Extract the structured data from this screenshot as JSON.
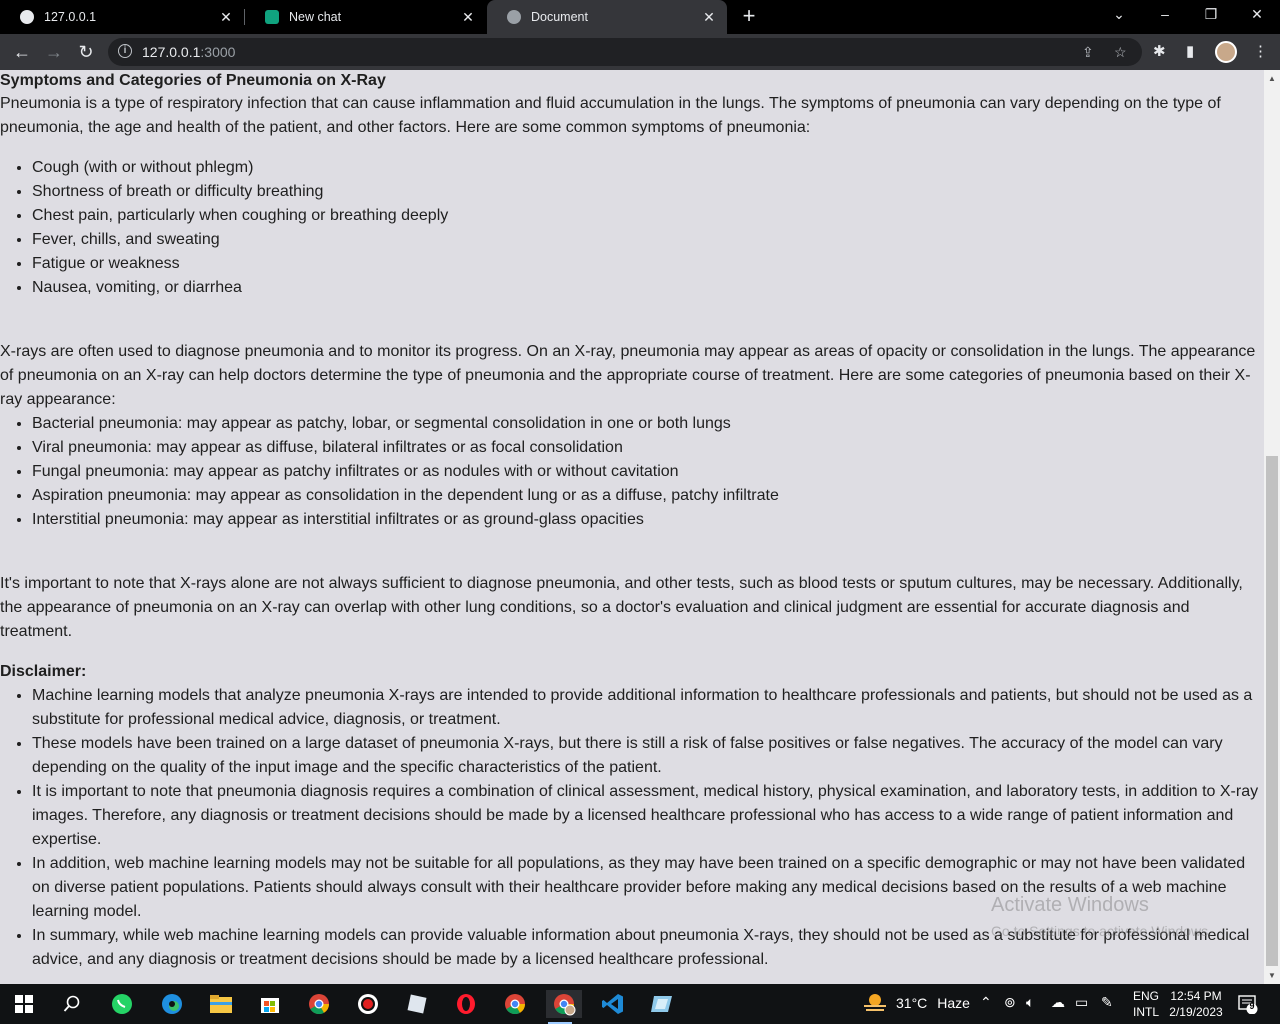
{
  "browser": {
    "tabs": [
      {
        "title": "127.0.0.1",
        "icon": "globe-icon"
      },
      {
        "title": "New chat",
        "icon": "chatgpt-icon"
      },
      {
        "title": "Document",
        "icon": "globe-icon",
        "active": true
      }
    ],
    "url_host": "127.0.0.1",
    "url_port": ":3000"
  },
  "page": {
    "heading": "Symptoms and Categories of Pneumonia on X-Ray",
    "intro": "Pneumonia is a type of respiratory infection that can cause inflammation and fluid accumulation in the lungs. The symptoms of pneumonia can vary depending on the type of pneumonia, the age and health of the patient, and other factors. Here are some common symptoms of pneumonia:",
    "symptoms": [
      "Cough (with or without phlegm)",
      "Shortness of breath or difficulty breathing",
      "Chest pain, particularly when coughing or breathing deeply",
      "Fever, chills, and sweating",
      "Fatigue or weakness",
      "Nausea, vomiting, or diarrhea"
    ],
    "xray_intro": "X-rays are often used to diagnose pneumonia and to monitor its progress. On an X-ray, pneumonia may appear as areas of opacity or consolidation in the lungs. The appearance of pneumonia on an X-ray can help doctors determine the type of pneumonia and the appropriate course of treatment. Here are some categories of pneumonia based on their X-ray appearance:",
    "categories": [
      "Bacterial pneumonia: may appear as patchy, lobar, or segmental consolidation in one or both lungs",
      "Viral pneumonia: may appear as diffuse, bilateral infiltrates or as focal consolidation",
      "Fungal pneumonia: may appear as patchy infiltrates or as nodules with or without cavitation",
      "Aspiration pneumonia: may appear as consolidation in the dependent lung or as a diffuse, patchy infiltrate",
      "Interstitial pneumonia: may appear as interstitial infiltrates or as ground-glass opacities"
    ],
    "note": "It's important to note that X-rays alone are not always sufficient to diagnose pneumonia, and other tests, such as blood tests or sputum cultures, may be necessary. Additionally, the appearance of pneumonia on an X-ray can overlap with other lung conditions, so a doctor's evaluation and clinical judgment are essential for accurate diagnosis and treatment.",
    "disclaimer_title": "Disclaimer:",
    "disclaimers": [
      "Machine learning models that analyze pneumonia X-rays are intended to provide additional information to healthcare professionals and patients, but should not be used as a substitute for professional medical advice, diagnosis, or treatment.",
      "These models have been trained on a large dataset of pneumonia X-rays, but there is still a risk of false positives or false negatives. The accuracy of the model can vary depending on the quality of the input image and the specific characteristics of the patient.",
      "It is important to note that pneumonia diagnosis requires a combination of clinical assessment, medical history, physical examination, and laboratory tests, in addition to X-ray images. Therefore, any diagnosis or treatment decisions should be made by a licensed healthcare professional who has access to a wide range of patient information and expertise.",
      "In addition, web machine learning models may not be suitable for all populations, as they may have been trained on a specific demographic or may not have been validated on diverse patient populations. Patients should always consult with their healthcare provider before making any medical decisions based on the results of a web machine learning model.",
      "In summary, while web machine learning models can provide valuable information about pneumonia X-rays, they should not be used as a substitute for professional medical advice, and any diagnosis or treatment decisions should be made by a licensed healthcare professional."
    ]
  },
  "watermark": {
    "line1": "Activate Windows",
    "line2": "Go to Settings to activate Windows."
  },
  "taskbar": {
    "weather_temp": "31°C",
    "weather_text": "Haze",
    "lang1": "ENG",
    "lang2": "INTL",
    "time": "12:54 PM",
    "date": "2/19/2023",
    "notifications": "9"
  },
  "colors": {
    "page_bg": "#dedde3",
    "chrome_dark": "#35363a",
    "tab_strip": "#000000",
    "taskbar": "#101214"
  }
}
